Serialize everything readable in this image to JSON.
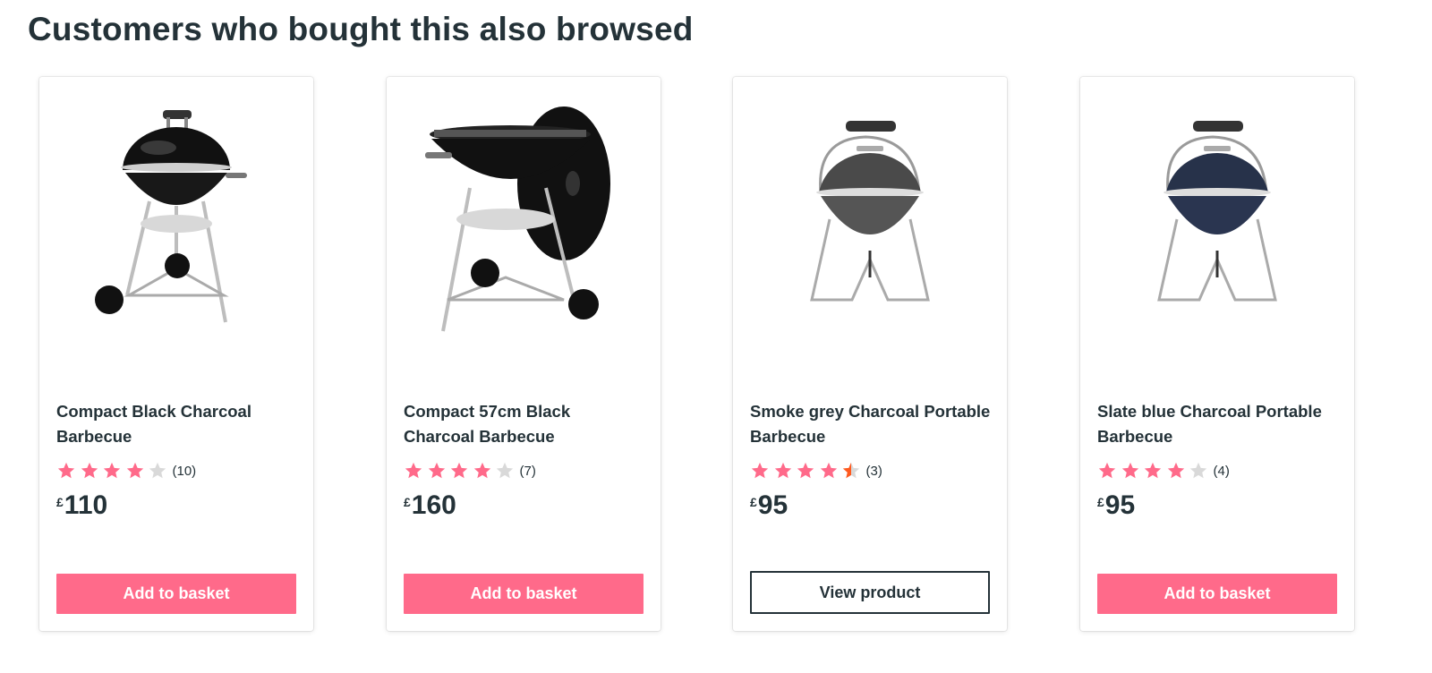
{
  "section": {
    "title": "Customers who bought this also browsed"
  },
  "colors": {
    "accent": "#ff6a8a",
    "star_filled": "#ff6a8a",
    "star_empty": "#d9d9d9",
    "star_half": "#ff5a1f",
    "text": "#243238"
  },
  "products": [
    {
      "name": "Compact Black Charcoal Barbecue",
      "rating": 4,
      "review_count": "(10)",
      "currency": "£",
      "price": "110",
      "button": "Add to basket",
      "image_icon": "kettle-bbq-black-icon"
    },
    {
      "name": "Compact 57cm Black Charcoal Barbecue",
      "rating": 4,
      "review_count": "(7)",
      "currency": "£",
      "price": "160",
      "button": "Add to basket",
      "image_icon": "kettle-bbq-open-lid-icon"
    },
    {
      "name": "Smoke grey Charcoal Portable Barbecue",
      "rating": 4.5,
      "review_count": "(3)",
      "currency": "£",
      "price": "95",
      "button": "View product",
      "image_icon": "portable-bbq-grey-icon"
    },
    {
      "name": "Slate blue Charcoal Portable Barbecue",
      "rating": 4,
      "review_count": "(4)",
      "currency": "£",
      "price": "95",
      "button": "Add to basket",
      "image_icon": "portable-bbq-blue-icon"
    }
  ]
}
